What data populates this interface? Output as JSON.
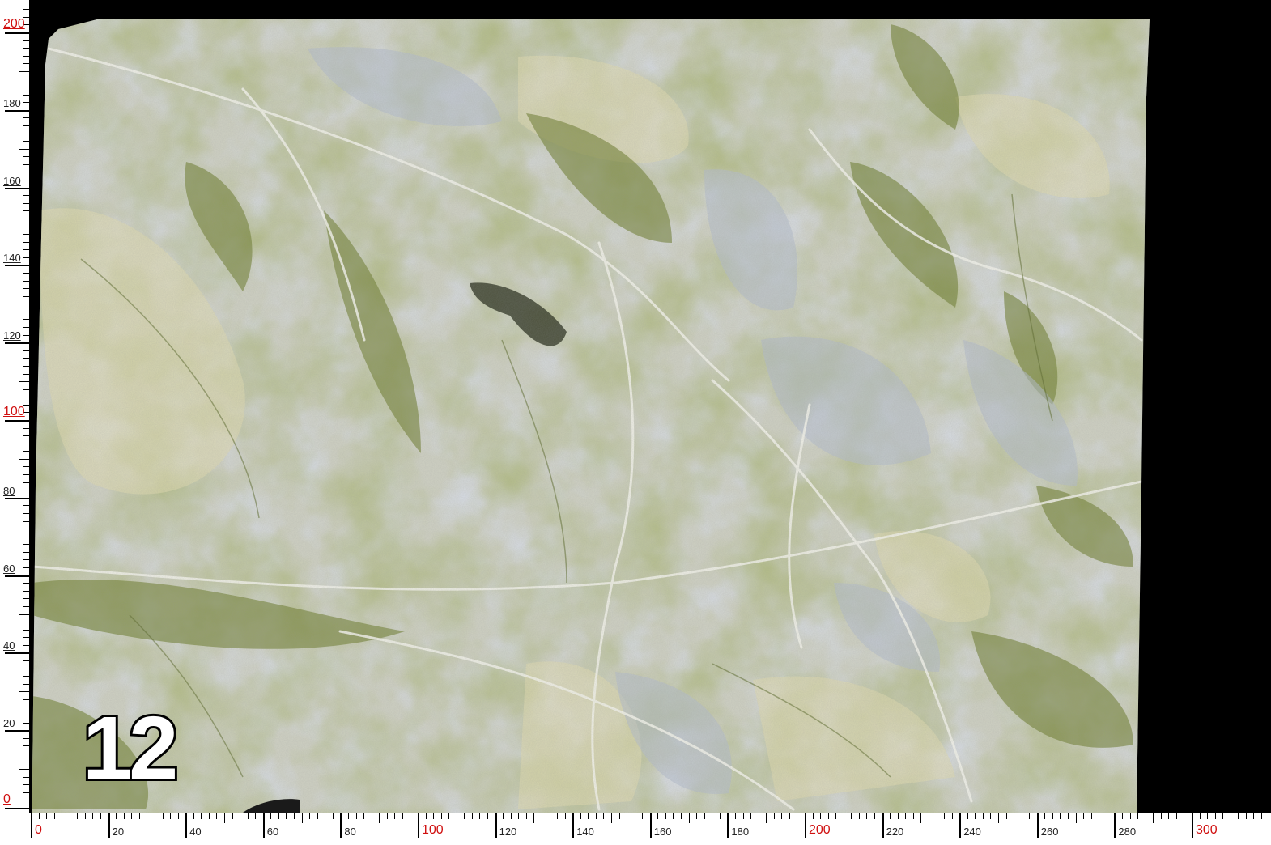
{
  "slab": {
    "number": "12",
    "material_colors": {
      "base": "#c9ccc0",
      "green": "#6e7d33",
      "cream": "#e3dfb8",
      "bluegrey": "#a9b3c2",
      "vein": "#f4f4ea"
    }
  },
  "ruler": {
    "x_ticks": [
      "0",
      "20",
      "40",
      "60",
      "80",
      "100",
      "120",
      "140",
      "160",
      "180",
      "200",
      "220",
      "240",
      "260",
      "280",
      "300"
    ],
    "y_ticks": [
      "0",
      "20",
      "40",
      "60",
      "80",
      "100",
      "120",
      "140",
      "160",
      "180",
      "200"
    ],
    "major_color": "#d01010"
  }
}
